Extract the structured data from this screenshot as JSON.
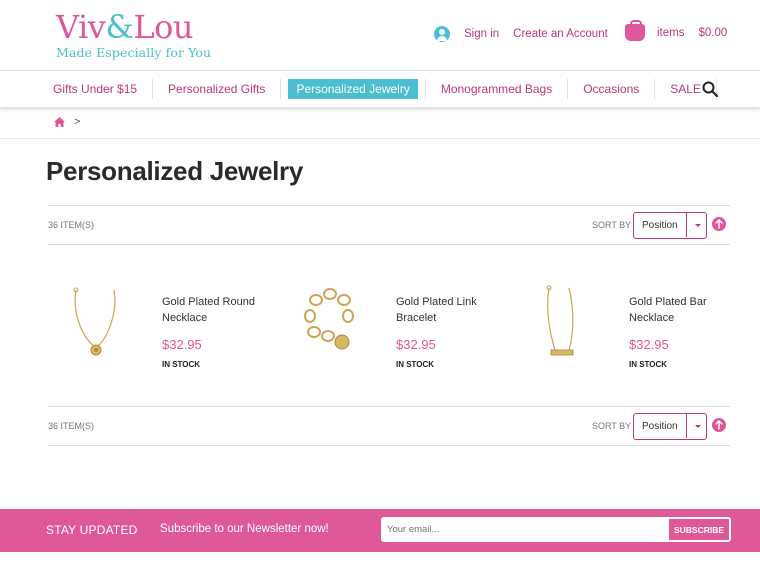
{
  "brand": {
    "name_part1": "Viv",
    "name_amp": "&",
    "name_part2": "Lou",
    "tagline": "Made Especially for You",
    "colors": {
      "pink": "#e0569a",
      "teal": "#4bbfcf",
      "dark_pink": "#c0357d"
    }
  },
  "account": {
    "icon": "user-icon",
    "signin_label": "Sign in",
    "create_label": "Create an Account"
  },
  "cart": {
    "icon": "shopping-bag-icon",
    "items_label": "items",
    "total": "$0.00"
  },
  "nav": {
    "items": [
      {
        "label": "Gifts Under $15"
      },
      {
        "label": "Personalized Gifts"
      },
      {
        "label": "Personalized Jewelry",
        "active": true
      },
      {
        "label": "Monogrammed Bags"
      },
      {
        "label": "Occasions"
      },
      {
        "label": "SALE"
      }
    ],
    "search_icon": "search-icon"
  },
  "breadcrumb": {
    "home_icon": "home-icon",
    "separator": ">"
  },
  "page_title": "Personalized Jewelry",
  "toolbar": {
    "count": "36 Item(s)",
    "sort_label": "Sort By",
    "sort_value": "Position",
    "direction_icon": "arrow-up-icon"
  },
  "products": [
    {
      "name": "Gold Plated Round Necklace",
      "price": "$32.95",
      "stock": "In stock",
      "image": "necklace-round"
    },
    {
      "name": "Gold Plated Link Bracelet",
      "price": "$32.95",
      "stock": "In stock",
      "image": "bracelet-link"
    },
    {
      "name": "Gold Plated Bar Necklace",
      "price": "$32.95",
      "stock": "In stock",
      "image": "necklace-bar"
    }
  ],
  "newsletter": {
    "title": "Stay Updated",
    "text": "Subscribe to our Newsletter now!",
    "placeholder": "Your email...",
    "button_label": "Subscribe"
  }
}
